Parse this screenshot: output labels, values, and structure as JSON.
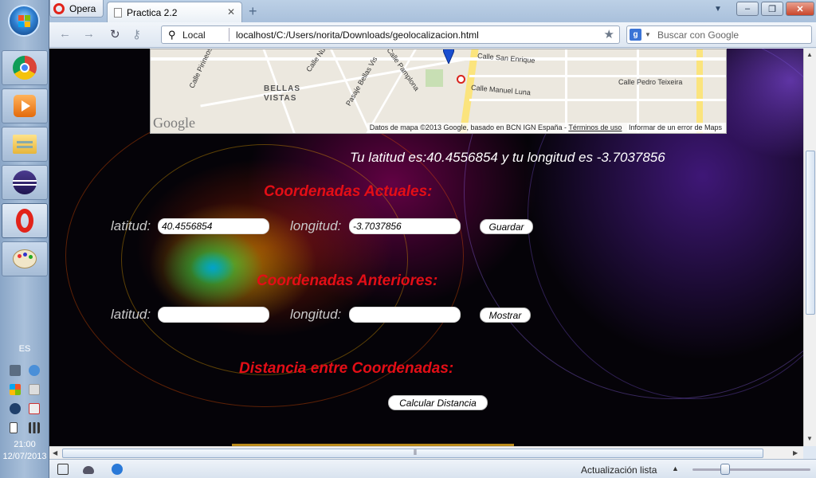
{
  "taskbar": {
    "language": "ES",
    "time": "21:00",
    "date": "12/07/2013",
    "apps": [
      "chrome",
      "media-player",
      "file-explorer",
      "eclipse",
      "opera",
      "paint"
    ]
  },
  "browser": {
    "menu_label": "Opera",
    "tab_title": "Practica 2.2",
    "address_scope": "Local",
    "url": "localhost/C:/Users/norita/Downloads/geolocalizacion.html",
    "search_placeholder": "Buscar con Google",
    "status_text": "Actualización lista"
  },
  "map": {
    "labels": {
      "street1": "Calle Pirineos",
      "street2": "Calle Nu",
      "street3": "Pasaje Bellas Vis",
      "street4": "Calle Pamplona",
      "street5": "Calle San Enrique",
      "street6": "Calle Manuel Luna",
      "street7": "Calle Pedro Teixeira",
      "district": "BELLAS VISTAS"
    },
    "attribution": "Datos de mapa ©2013 Google, basado en BCN IGN España - ",
    "terms": "Términos de uso",
    "report": "Informar de un error de Maps",
    "logo": "Google"
  },
  "page": {
    "geo_message": "Tu latitud es:40.4556854 y tu longitud es -3.7037856",
    "current": {
      "title": "Coordenadas Actuales:",
      "lat_label": "latitud:",
      "lat_value": "40.4556854",
      "lon_label": "longitud:",
      "lon_value": "-3.7037856",
      "button": "Guardar"
    },
    "previous": {
      "title": "Coordenadas Anteriores:",
      "lat_label": "latitud:",
      "lat_value": "",
      "lon_label": "longitud:",
      "lon_value": "",
      "button": "Mostrar"
    },
    "distance": {
      "title": "Distancia entre Coordenadas:",
      "button": "Calcular Distancia"
    }
  },
  "colors": {
    "section_title": "#e30e16",
    "label": "#c9c9c9",
    "background": "#050308"
  }
}
